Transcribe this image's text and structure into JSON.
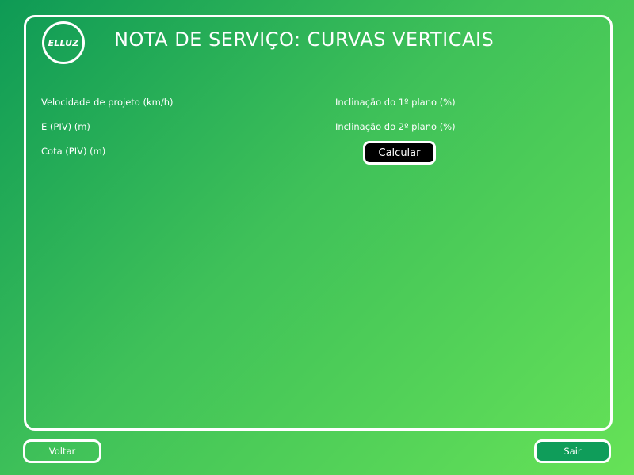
{
  "header": {
    "logo_text": "ELLUZ",
    "title": "NOTA DE SERVIÇO: CURVAS VERTICAIS"
  },
  "form": {
    "left_fields": [
      {
        "label": "Velocidade de projeto (km/h)"
      },
      {
        "label": "E (PIV) (m)"
      },
      {
        "label": "Cota (PIV) (m)"
      }
    ],
    "right_fields": [
      {
        "label": "Inclinação do 1º  plano (%)"
      },
      {
        "label": "Inclinação do 2º plano (%)"
      }
    ],
    "calculate_label": "Calcular"
  },
  "footer": {
    "back_label": "Voltar",
    "exit_label": "Sair"
  },
  "colors": {
    "gradient_start": "#0e9a55",
    "gradient_end": "#66e257",
    "calculate_bg": "#000000",
    "exit_bg": "#0f9d5a",
    "text": "#ffffff"
  }
}
